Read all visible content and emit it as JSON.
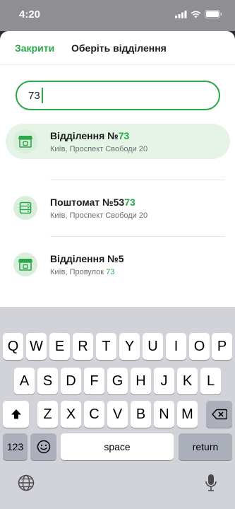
{
  "status": {
    "time": "4:20"
  },
  "header": {
    "close_label": "Закрити",
    "title": "Оберіть відділення"
  },
  "search": {
    "value": "73"
  },
  "branches": [
    {
      "title_prefix": "Відділення №",
      "title_highlight": "73",
      "address_prefix": "Київ, Проспект Свободи 20",
      "address_highlight": "",
      "icon": "store-icon",
      "selected": true
    },
    {
      "title_prefix": "Поштомат №53",
      "title_highlight": "73",
      "address_prefix": "Київ, Проспект Свободи 20",
      "address_highlight": "",
      "icon": "parcel-locker-icon",
      "selected": false
    },
    {
      "title_prefix": "Відділення №5",
      "title_highlight": "",
      "address_prefix": "Київ, Провулок ",
      "address_highlight": "73",
      "icon": "store-icon",
      "selected": false
    }
  ],
  "keyboard": {
    "row1": [
      "Q",
      "W",
      "E",
      "R",
      "T",
      "Y",
      "U",
      "I",
      "O",
      "P"
    ],
    "row2": [
      "A",
      "S",
      "D",
      "F",
      "G",
      "H",
      "J",
      "K",
      "L"
    ],
    "row3": [
      "Z",
      "X",
      "C",
      "V",
      "B",
      "N",
      "M"
    ],
    "numbers_label": "123",
    "space_label": "space",
    "return_label": "return"
  },
  "colors": {
    "accent": "#2aa84a",
    "selected_bg": "#e5f4e6"
  }
}
